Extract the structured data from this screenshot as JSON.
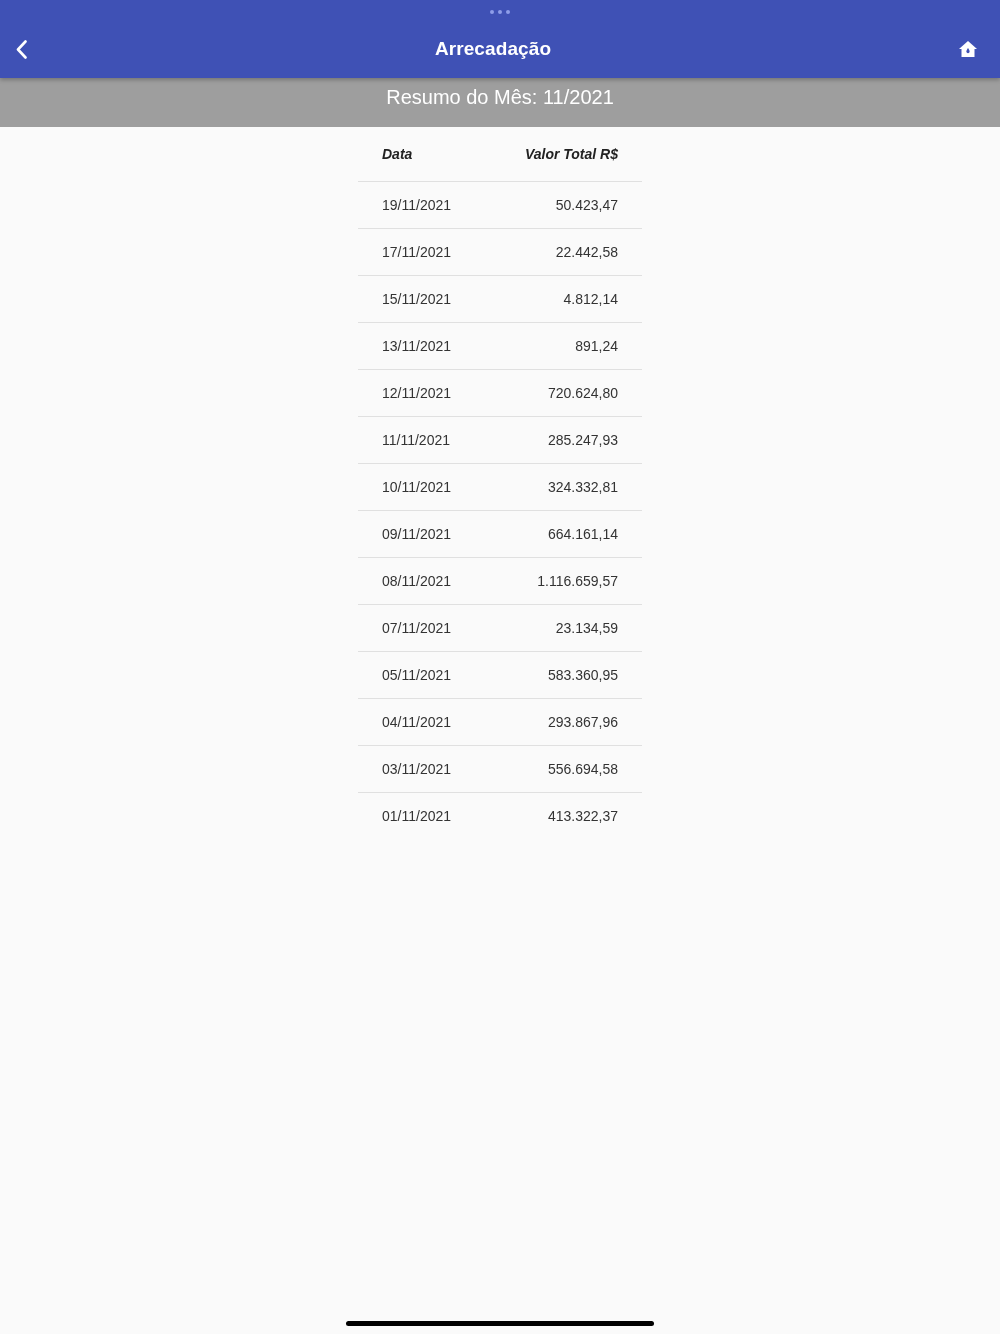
{
  "app_bar": {
    "title": "Arrecadação"
  },
  "summary": {
    "title": "Resumo do Mês: 11/2021"
  },
  "table": {
    "columns": [
      "Data",
      "Valor Total R$"
    ],
    "rows": [
      [
        "19/11/2021",
        "50.423,47"
      ],
      [
        "17/11/2021",
        "22.442,58"
      ],
      [
        "15/11/2021",
        "4.812,14"
      ],
      [
        "13/11/2021",
        "891,24"
      ],
      [
        "12/11/2021",
        "720.624,80"
      ],
      [
        "11/11/2021",
        "285.247,93"
      ],
      [
        "10/11/2021",
        "324.332,81"
      ],
      [
        "09/11/2021",
        "664.161,14"
      ],
      [
        "08/11/2021",
        "1.116.659,57"
      ],
      [
        "07/11/2021",
        "23.134,59"
      ],
      [
        "05/11/2021",
        "583.360,95"
      ],
      [
        "04/11/2021",
        "293.867,96"
      ],
      [
        "03/11/2021",
        "556.694,58"
      ],
      [
        "01/11/2021",
        "413.322,37"
      ]
    ]
  }
}
